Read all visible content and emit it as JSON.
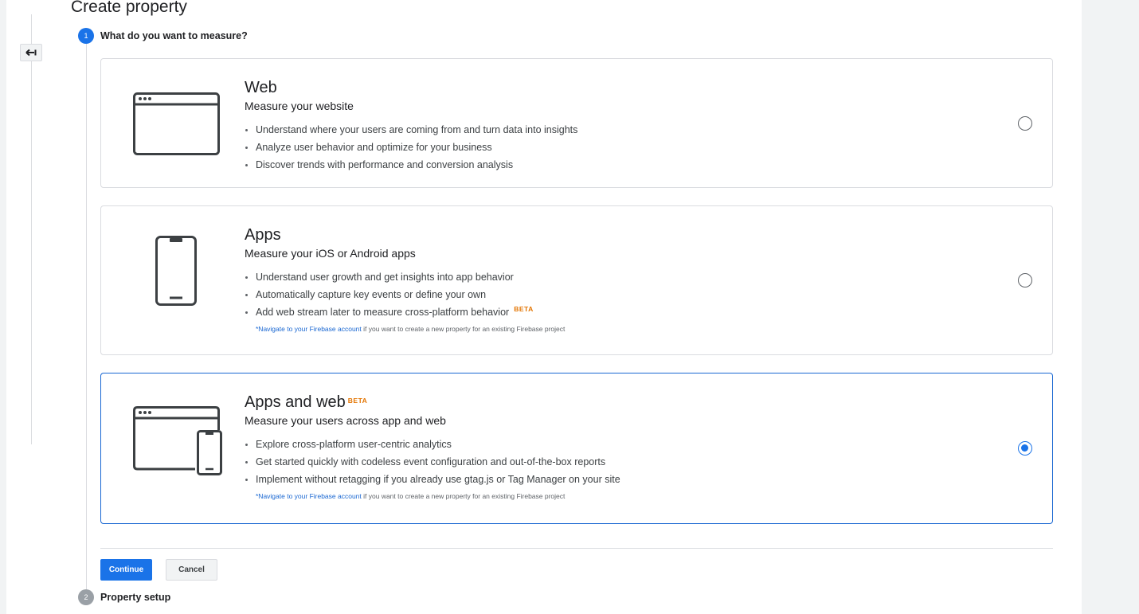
{
  "header": {
    "title": "Create property"
  },
  "nav": {
    "back_icon": "arrow-back-icon"
  },
  "steps": [
    {
      "number": "1",
      "label": "What do you want to measure?"
    },
    {
      "number": "2",
      "label": "Property setup"
    }
  ],
  "options": {
    "web": {
      "title": "Web",
      "subtitle": "Measure your website",
      "bullets": [
        "Understand where your users are coming from and turn data into insights",
        "Analyze user behavior and optimize for your business",
        "Discover trends with performance and conversion analysis"
      ],
      "selected": false
    },
    "apps": {
      "title": "Apps",
      "subtitle": "Measure your iOS or Android apps",
      "bullets": [
        "Understand user growth and get insights into app behavior",
        "Automatically capture key events or define your own",
        "Add web stream later to measure cross-platform behavior"
      ],
      "bullet_badge": "BETA",
      "note_link": "*Navigate to your Firebase account",
      "note_text": " if you want to create a new property for an existing Firebase project",
      "selected": false
    },
    "apps_web": {
      "title": "Apps and web",
      "badge": "BETA",
      "subtitle": "Measure your users across app and web",
      "bullets": [
        "Explore cross-platform user-centric analytics",
        "Get started quickly with codeless event configuration and out-of-the-box reports",
        "Implement without retagging if you already use gtag.js or Tag Manager on your site"
      ],
      "note_link": "*Navigate to your Firebase account",
      "note_text": " if you want to create a new property for an existing Firebase project",
      "selected": true
    }
  },
  "actions": {
    "continue_label": "Continue",
    "cancel_label": "Cancel"
  },
  "colors": {
    "accent": "#1a73e8",
    "beta": "#e37400",
    "border": "#dadce0"
  }
}
